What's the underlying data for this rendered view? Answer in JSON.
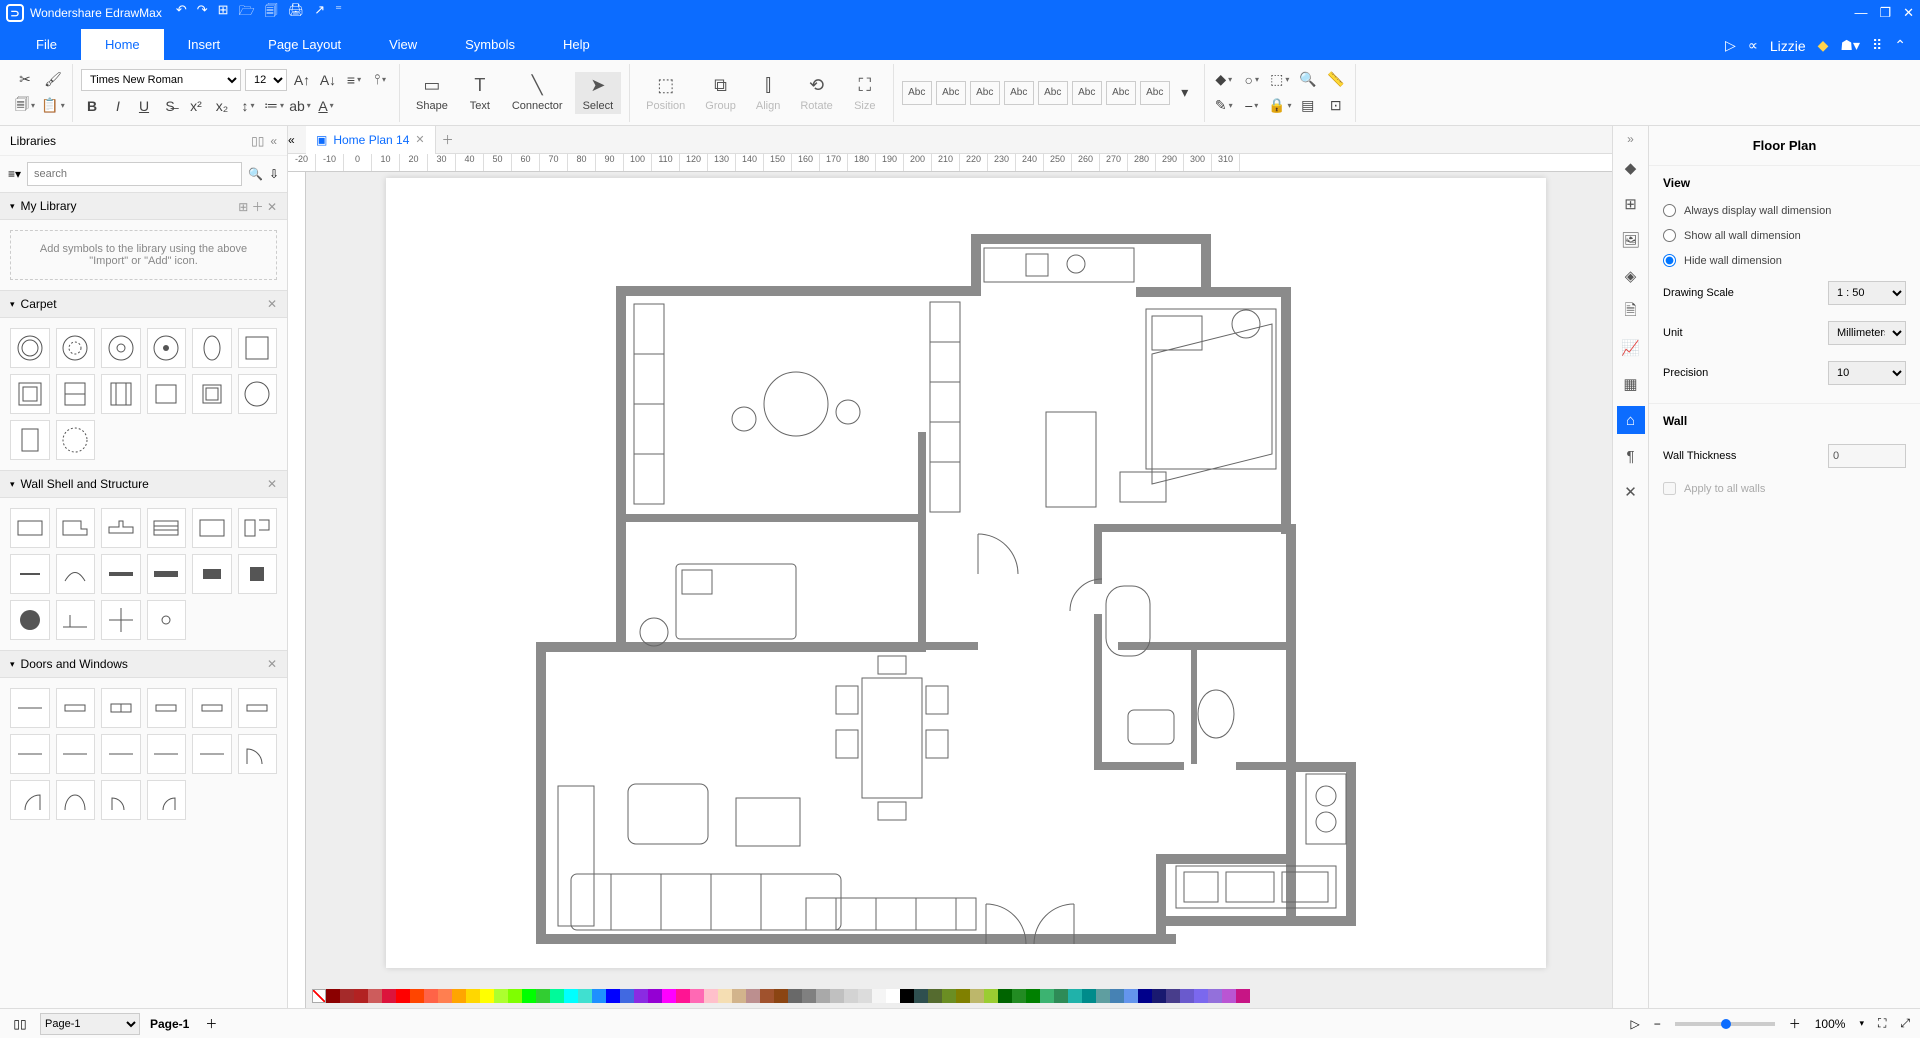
{
  "app": {
    "name": "Wondershare EdrawMax"
  },
  "tabs": [
    "File",
    "Home",
    "Insert",
    "Page Layout",
    "View",
    "Symbols",
    "Help"
  ],
  "active_tab": "Home",
  "user": "Lizzie",
  "ribbon": {
    "font": "Times New Roman",
    "size": "12",
    "tools": {
      "shape": "Shape",
      "text": "Text",
      "connector": "Connector",
      "select": "Select",
      "position": "Position",
      "group": "Group",
      "align": "Align",
      "rotate": "Rotate",
      "size_lbl": "Size"
    },
    "abc": "Abc"
  },
  "library": {
    "title": "Libraries",
    "search_ph": "search",
    "my_library": "My Library",
    "hint": "Add symbols to the library using the above \"Import\" or \"Add\" icon.",
    "sections": [
      "Carpet",
      "Wall Shell and Structure",
      "Doors and Windows"
    ]
  },
  "doc_tab": "Home Plan 14",
  "ruler_vals": [
    "-20",
    "-10",
    "0",
    "10",
    "20",
    "30",
    "40",
    "50",
    "60",
    "70",
    "80",
    "90",
    "100",
    "110",
    "120",
    "130",
    "140",
    "150",
    "160",
    "170",
    "180",
    "190",
    "200",
    "210",
    "220",
    "230",
    "240",
    "250",
    "260",
    "270",
    "280",
    "290",
    "300",
    "310"
  ],
  "rpanel": {
    "title": "Floor Plan",
    "view": "View",
    "r_always": "Always display wall dimension",
    "r_show": "Show all wall dimension",
    "r_hide": "Hide wall dimension",
    "scale": "Drawing Scale",
    "scale_val": "1 : 50",
    "unit": "Unit",
    "unit_val": "Millimeters",
    "precision": "Precision",
    "precision_val": "10",
    "wall": "Wall",
    "thick": "Wall Thickness",
    "thick_val": "0",
    "apply": "Apply to all walls"
  },
  "status": {
    "page_sel": "Page-1",
    "page_name": "Page-1",
    "zoom": "100%"
  }
}
